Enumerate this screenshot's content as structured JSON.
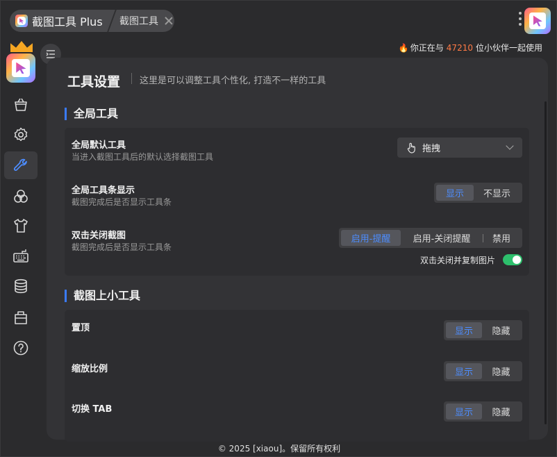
{
  "tabs": {
    "main_label": "截图工具 Plus",
    "sub_label": "截图工具"
  },
  "header": {
    "users_prefix": "你正在与",
    "users_count": "47210",
    "users_suffix": "位小伙伴一起使用"
  },
  "sidebar": {
    "items": [
      {
        "icon": "shopping-bag-icon",
        "active": false
      },
      {
        "icon": "gear-icon",
        "active": false
      },
      {
        "icon": "wrench-icon",
        "active": true
      },
      {
        "icon": "color-circles-icon",
        "active": false
      },
      {
        "icon": "tshirt-icon",
        "active": false
      },
      {
        "icon": "keyboard-icon",
        "active": false
      },
      {
        "icon": "database-icon",
        "active": false
      },
      {
        "icon": "briefcase-icon",
        "active": false
      },
      {
        "icon": "help-icon",
        "active": false
      }
    ]
  },
  "page": {
    "title": "工具设置",
    "subtitle": "这里是可以调整工具个性化, 打造不一样的工具"
  },
  "global_tools": {
    "heading": "全局工具",
    "default_tool": {
      "title": "全局默认工具",
      "desc": "当进入截图工具后的默认选择截图工具",
      "value": "拖拽"
    },
    "toolbar_display": {
      "title": "全局工具条显示",
      "desc": "截图完成后是否显示工具条",
      "options": [
        "显示",
        "不显示"
      ],
      "selected": "显示"
    },
    "double_click_close": {
      "title": "双击关闭截图",
      "desc": "截图完成后是否显示工具条",
      "options": [
        "启用-提醒",
        "启用-关闭提醒",
        "禁用"
      ],
      "selected": "启用-提醒",
      "copy_toggle_label": "双击关闭并复制图片",
      "copy_toggle_on": true
    }
  },
  "mini_tools": {
    "heading": "截图上小工具",
    "rows": [
      {
        "title": "置顶",
        "options": [
          "显示",
          "隐藏"
        ],
        "selected": "显示"
      },
      {
        "title": "缩放比例",
        "options": [
          "显示",
          "隐藏"
        ],
        "selected": "显示"
      },
      {
        "title": "切换 TAB",
        "options": [
          "显示",
          "隐藏"
        ],
        "selected": "显示"
      }
    ]
  },
  "footer": {
    "text": "© 2025 [xiaou]。保留所有权利"
  },
  "colors": {
    "accent": "#4d8dff",
    "section_bar": "#3a7bff",
    "toggle_on": "#2dbf6c",
    "highlight_count": "#ff7a45"
  }
}
